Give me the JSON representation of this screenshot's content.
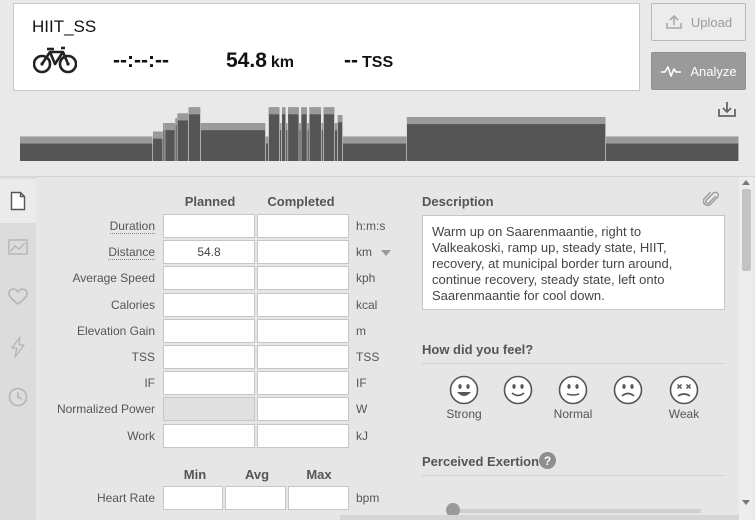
{
  "header": {
    "workout_title": "HIIT_SS",
    "sport_icon": "bike-icon",
    "duration": "--:--:--",
    "distance_value": "54.8",
    "distance_unit": "km",
    "tss_value": "--",
    "tss_unit": "TSS"
  },
  "actions": {
    "upload_label": "Upload",
    "upload_icon": "upload-icon",
    "analyze_label": "Analyze",
    "analyze_icon": "pulse-icon",
    "download_icon": "download-icon"
  },
  "colors": {
    "profile_fill": "#555555",
    "profile_band": "#9a9a9a",
    "analyze_bg": "#9a9a9a"
  },
  "profile": {
    "segments": [
      {
        "w": 131,
        "level": 0.4
      },
      {
        "w": 10,
        "level": 0.48
      },
      {
        "w": 2,
        "level": 0.62
      },
      {
        "w": 10,
        "level": 0.62
      },
      {
        "w": 2,
        "level": 0.7
      },
      {
        "w": 11,
        "level": 0.78
      },
      {
        "w": 12,
        "level": 0.88
      },
      {
        "w": 64,
        "level": 0.62
      },
      {
        "w": 3,
        "level": 0.4
      },
      {
        "w": 11,
        "level": 0.88
      },
      {
        "w": 2,
        "level": 0.62
      },
      {
        "w": 4,
        "level": 0.88
      },
      {
        "w": 2,
        "level": 0.62
      },
      {
        "w": 11,
        "level": 0.88
      },
      {
        "w": 2,
        "level": 0.62
      },
      {
        "w": 6,
        "level": 0.88
      },
      {
        "w": 2,
        "level": 0.62
      },
      {
        "w": 12,
        "level": 0.88
      },
      {
        "w": 2,
        "level": 0.62
      },
      {
        "w": 11,
        "level": 0.88
      },
      {
        "w": 3,
        "level": 0.62
      },
      {
        "w": 5,
        "level": 0.75
      },
      {
        "w": 63,
        "level": 0.4
      },
      {
        "w": 196,
        "level": 0.72
      },
      {
        "w": 131,
        "level": 0.4
      }
    ]
  },
  "side_tabs": [
    {
      "name": "document-icon",
      "active": true
    },
    {
      "name": "chart-icon",
      "active": false
    },
    {
      "name": "heart-icon",
      "active": false
    },
    {
      "name": "lightning-icon",
      "active": false
    },
    {
      "name": "clock-icon",
      "active": false
    }
  ],
  "metrics_table": {
    "col_planned": "Planned",
    "col_completed": "Completed",
    "rows": [
      {
        "label": "Duration",
        "planned": "",
        "completed": "",
        "unit": "h:m:s",
        "dotted": true
      },
      {
        "label": "Distance",
        "planned": "54.8",
        "completed": "",
        "unit": "km",
        "dotted": true,
        "has_dropdown": true
      },
      {
        "label": "Average Speed",
        "planned": "",
        "completed": "",
        "unit": "kph"
      },
      {
        "label": "Calories",
        "planned": "",
        "completed": "",
        "unit": "kcal"
      },
      {
        "label": "Elevation Gain",
        "planned": "",
        "completed": "",
        "unit": "m"
      },
      {
        "label": "TSS",
        "planned": "",
        "completed": "",
        "unit": "TSS"
      },
      {
        "label": "IF",
        "planned": "",
        "completed": "",
        "unit": "IF"
      },
      {
        "label": "Normalized Power",
        "planned": "",
        "completed": "",
        "unit": "W",
        "planned_disabled": true
      },
      {
        "label": "Work",
        "planned": "",
        "completed": "",
        "unit": "kJ"
      }
    ]
  },
  "hr_table": {
    "col_min": "Min",
    "col_avg": "Avg",
    "col_max": "Max",
    "row_label": "Heart Rate",
    "min": "",
    "avg": "",
    "max": "",
    "unit": "bpm"
  },
  "description": {
    "title": "Description",
    "attach_icon": "paperclip-icon",
    "text": "Warm up on Saarenmaantie, right to Valkeakoski, ramp up, steady state, HIIT, recovery, at municipal border turn around, continue recovery, steady state, left onto Saarenmaantie for cool down."
  },
  "feeling": {
    "title": "How did you feel?",
    "faces": [
      {
        "icon": "very-happy-face-icon",
        "label": "Strong"
      },
      {
        "icon": "happy-face-icon",
        "label": ""
      },
      {
        "icon": "neutral-face-icon",
        "label": "Normal"
      },
      {
        "icon": "sad-face-icon",
        "label": ""
      },
      {
        "icon": "dizzy-face-icon",
        "label": "Weak"
      }
    ]
  },
  "exertion": {
    "title": "Perceived Exertion",
    "help_glyph": "?",
    "value": 0
  }
}
